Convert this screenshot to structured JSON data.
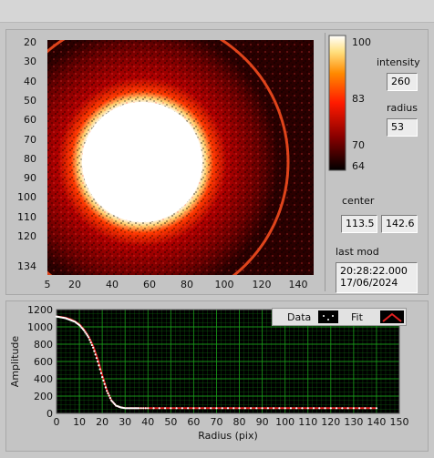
{
  "image": {
    "y_ticks": [
      "20",
      "30",
      "40",
      "50",
      "60",
      "70",
      "80",
      "90",
      "100",
      "110",
      "120",
      "134"
    ],
    "x_ticks": [
      "5",
      "20",
      "40",
      "60",
      "80",
      "100",
      "120",
      "140"
    ]
  },
  "colorbar": {
    "ticks": [
      "100",
      "83",
      "70",
      "64"
    ]
  },
  "intensity": {
    "label": "intensity",
    "value": "260"
  },
  "radius": {
    "label": "radius",
    "value": "53"
  },
  "center": {
    "label": "center",
    "x": "113.5",
    "y": "142.6"
  },
  "last_mod": {
    "label": "last mod",
    "time": "20:28:22.000",
    "date": "17/06/2024"
  },
  "plot": {
    "legend": {
      "data_label": "Data",
      "fit_label": "Fit"
    }
  },
  "chart_data": {
    "type": "scatter",
    "xlabel": "Radius (pix)",
    "ylabel": "Amplitude",
    "xlim": [
      0,
      150
    ],
    "ylim": [
      0,
      1200
    ],
    "x_ticks": [
      "0",
      "10",
      "20",
      "30",
      "40",
      "50",
      "60",
      "70",
      "80",
      "90",
      "100",
      "110",
      "120",
      "130",
      "140",
      "150"
    ],
    "y_ticks": [
      "0",
      "200",
      "400",
      "600",
      "800",
      "1000",
      "1200"
    ],
    "colors": {
      "data": "#ffffff",
      "fit": "#e02020",
      "background": "#000000",
      "grid": "#1aa01a"
    },
    "series": [
      {
        "name": "Data",
        "x": [
          0,
          2,
          4,
          6,
          8,
          10,
          12,
          14,
          16,
          18,
          20,
          22,
          24,
          26,
          28,
          30,
          32,
          34,
          36,
          40,
          50,
          60,
          70,
          80,
          90,
          100,
          110,
          120,
          130,
          140
        ],
        "y": [
          1120,
          1110,
          1100,
          1080,
          1060,
          1020,
          960,
          880,
          760,
          600,
          420,
          260,
          150,
          90,
          70,
          60,
          60,
          60,
          60,
          60,
          60,
          60,
          60,
          60,
          60,
          60,
          60,
          60,
          60,
          60
        ]
      },
      {
        "name": "Fit",
        "x": [
          0,
          2,
          4,
          6,
          8,
          10,
          12,
          14,
          16,
          18,
          20,
          22,
          24,
          26,
          28,
          30,
          32,
          34,
          36,
          40,
          50,
          60,
          70,
          80,
          90,
          100,
          110,
          120,
          130,
          140
        ],
        "y": [
          1120,
          1115,
          1105,
          1090,
          1065,
          1030,
          970,
          890,
          780,
          630,
          440,
          270,
          150,
          90,
          70,
          62,
          60,
          60,
          60,
          60,
          60,
          60,
          60,
          60,
          60,
          60,
          60,
          60,
          60,
          60
        ]
      }
    ]
  }
}
